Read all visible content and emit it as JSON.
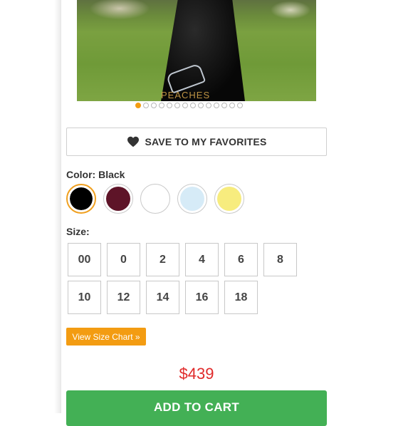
{
  "product_image": {
    "watermark": "PEACHES",
    "carousel_dot_count": 14,
    "active_dot_index": 0
  },
  "favorites": {
    "label": "SAVE TO MY FAVORITES",
    "icon": "heart-icon"
  },
  "color": {
    "label": "Color: Black",
    "selected": "Black",
    "swatches": [
      {
        "name": "Black",
        "hex": "#000000"
      },
      {
        "name": "Burgundy",
        "hex": "#5e1428"
      },
      {
        "name": "White",
        "hex": "#ffffff"
      },
      {
        "name": "Light Blue",
        "hex": "#d6ebf7"
      },
      {
        "name": "Yellow",
        "hex": "#f7ec7e"
      }
    ]
  },
  "size": {
    "label": "Size:",
    "options": [
      "00",
      "0",
      "2",
      "4",
      "6",
      "8",
      "10",
      "12",
      "14",
      "16",
      "18"
    ]
  },
  "size_chart": {
    "label": "View Size Chart »"
  },
  "price": "$439",
  "add_to_cart": {
    "label": "ADD TO CART"
  },
  "colors": {
    "accent": "#f39c12",
    "price": "#e02a2a",
    "cart_button": "#43b055"
  }
}
